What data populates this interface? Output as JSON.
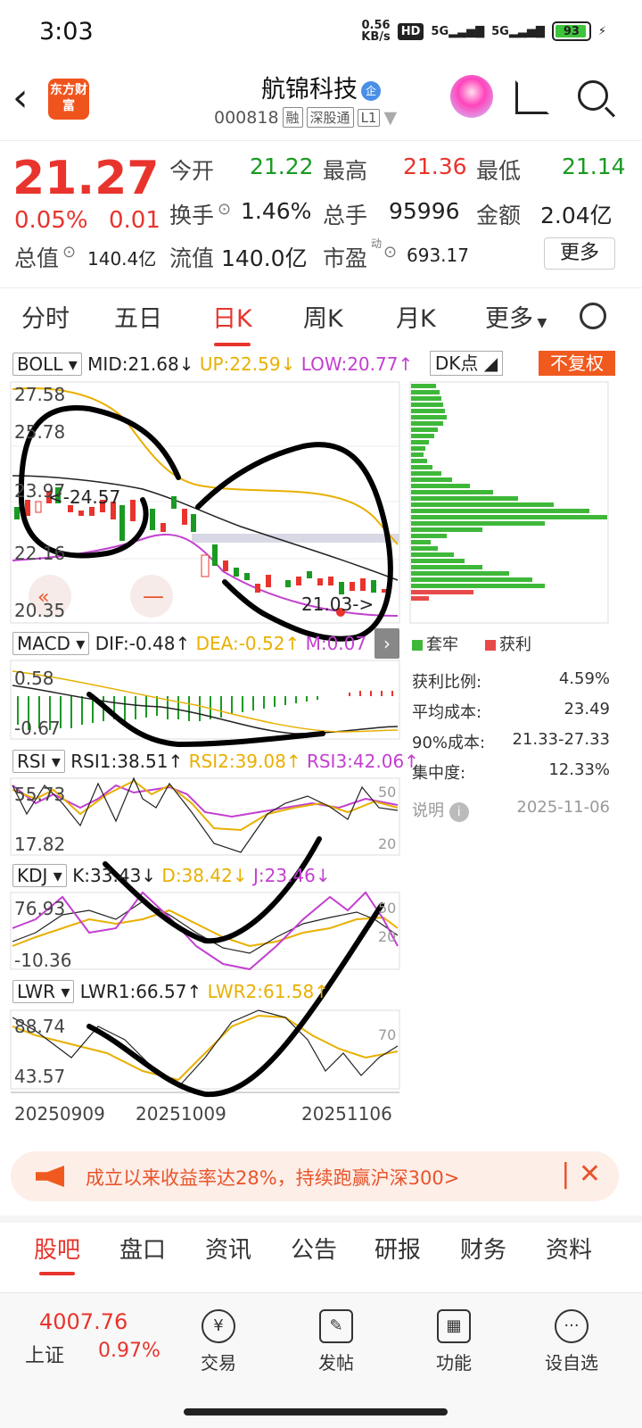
{
  "status": {
    "time": "3:03",
    "net_speed": "0.56",
    "net_unit": "KB/s",
    "hd": "HD",
    "sig1": "5G",
    "sig2": "5G",
    "battery": "93"
  },
  "header": {
    "logo": "东方财富",
    "name": "航锦科技",
    "badge": "企",
    "code": "000818",
    "tag1": "融",
    "tag2": "深股通",
    "tag3": "L1"
  },
  "quote": {
    "price": "21.27",
    "pct": "0.05%",
    "chg": "0.01",
    "open_l": "今开",
    "open_v": "21.22",
    "high_l": "最高",
    "high_v": "21.36",
    "low_l": "最低",
    "low_v": "21.14",
    "turn_l": "换手",
    "turn_v": "1.46%",
    "vol_l": "总手",
    "vol_v": "95996",
    "amt_l": "金额",
    "amt_v": "2.04亿",
    "mcap_l": "总值",
    "mcap_v": "140.4亿",
    "float_l": "流值",
    "float_v": "140.0亿",
    "pe_l": "市盈",
    "pe_sup": "动",
    "pe_v": "693.17",
    "more": "更多"
  },
  "tabs": [
    "分时",
    "五日",
    "日K",
    "周K",
    "月K",
    "更多"
  ],
  "boll": {
    "name": "BOLL",
    "mid": "MID:21.68",
    "up": "UP:22.59",
    "low": "LOW:20.77",
    "dk": "DK点",
    "fq": "不复权",
    "y": [
      "27.58",
      "25.78",
      "23.97",
      "22.16",
      "20.35"
    ],
    "hi_label": "<-24.57",
    "lo_label": "21.03->"
  },
  "macd": {
    "name": "MACD",
    "dif": "DIF:-0.48",
    "dea": "DEA:-0.52",
    "m": "M:0.07",
    "y": [
      "0.58",
      "-0.67"
    ]
  },
  "rsi": {
    "name": "RSI",
    "r1": "RSI1:38.51",
    "r2": "RSI2:39.08",
    "r3": "RSI3:42.06",
    "y": [
      "55.73",
      "17.82"
    ],
    "r": [
      "50",
      "20"
    ]
  },
  "kdj": {
    "name": "KDJ",
    "k": "K:33.43",
    "d": "D:38.42",
    "j": "J:23.46",
    "y": [
      "76.93",
      "-10.36"
    ],
    "r": [
      "50",
      "20"
    ]
  },
  "lwr": {
    "name": "LWR",
    "l1": "LWR1:66.57",
    "l2": "LWR2:61.58",
    "y": [
      "88.74",
      "43.57"
    ],
    "r": [
      "70"
    ]
  },
  "dates": [
    "20250909",
    "20251009",
    "20251106"
  ],
  "chip": {
    "legend1": "套牢",
    "legend2": "获利",
    "rows": [
      {
        "l": "获利比例:",
        "v": "4.59%"
      },
      {
        "l": "平均成本:",
        "v": "23.49"
      },
      {
        "l": "90%成本:",
        "v": "21.33-27.33"
      },
      {
        "l": "集中度:",
        "v": "12.33%"
      }
    ],
    "note_l": "说明",
    "note_date": "2025-11-06"
  },
  "promo": "成立以来收益率达28%，持续跑赢沪深300>",
  "subtabs": [
    "股吧",
    "盘口",
    "资讯",
    "公告",
    "研报",
    "财务",
    "资料"
  ],
  "bottom": {
    "index_val": "4007.76",
    "index_name": "上证",
    "index_pct": "0.97%",
    "items": [
      "交易",
      "发帖",
      "功能",
      "设自选"
    ]
  }
}
